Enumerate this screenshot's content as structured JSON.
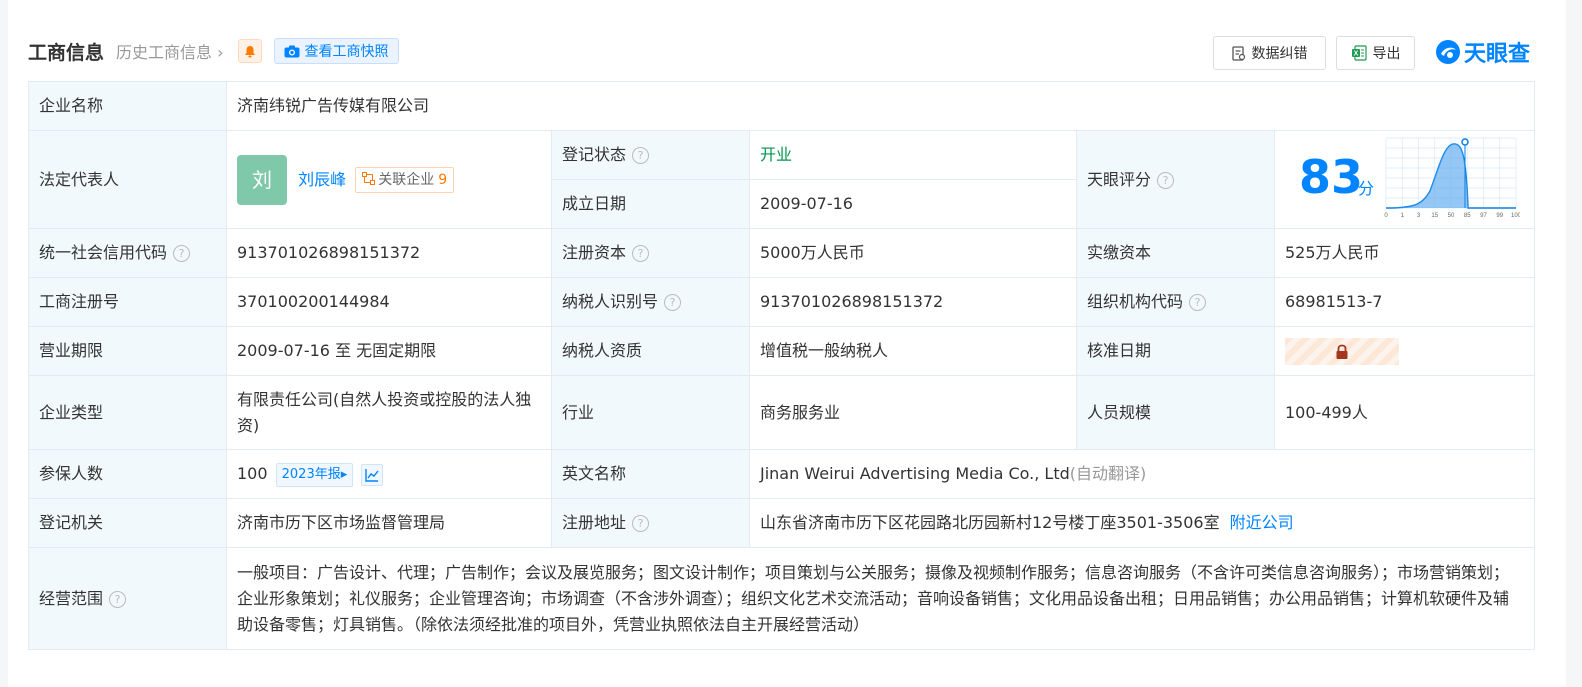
{
  "header": {
    "title": "工商信息",
    "history_link": "历史工商信息",
    "snapshot_button": "查看工商快照",
    "data_correction_button": "数据纠错",
    "export_button": "导出",
    "brand": "天眼查"
  },
  "company": {
    "name_label": "企业名称",
    "name": "济南纬锐广告传媒有限公司",
    "legal_rep_label": "法定代表人",
    "legal_rep_avatar": "刘",
    "legal_rep": "刘辰峰",
    "related_label": "关联企业",
    "related_count": "9",
    "status_label": "登记状态",
    "status": "开业",
    "established_label": "成立日期",
    "established": "2009-07-16",
    "score_label": "天眼评分",
    "score": "83",
    "score_unit": "分",
    "score_axis": [
      "0",
      "1",
      "3",
      "15",
      "50",
      "85",
      "97",
      "99",
      "100"
    ],
    "credit_code_label": "统一社会信用代码",
    "credit_code": "913701026898151372",
    "reg_capital_label": "注册资本",
    "reg_capital": "5000万人民币",
    "paid_capital_label": "实缴资本",
    "paid_capital": "525万人民币",
    "reg_number_label": "工商注册号",
    "reg_number": "370100200144984",
    "taxpayer_id_label": "纳税人识别号",
    "taxpayer_id": "913701026898151372",
    "org_code_label": "组织机构代码",
    "org_code": "68981513-7",
    "term_label": "营业期限",
    "term": "2009-07-16 至 无固定期限",
    "taxpayer_qual_label": "纳税人资质",
    "taxpayer_qual": "增值税一般纳税人",
    "approval_date_label": "核准日期",
    "type_label": "企业类型",
    "type": "有限责任公司(自然人投资或控股的法人独资)",
    "industry_label": "行业",
    "industry": "商务服务业",
    "staff_label": "人员规模",
    "staff": "100-499人",
    "insured_label": "参保人数",
    "insured": "100",
    "annual_report": "2023年报",
    "english_name_label": "英文名称",
    "english_name": "Jinan Weirui Advertising Media Co., Ltd",
    "auto_translate": "(自动翻译)",
    "authority_label": "登记机关",
    "authority": "济南市历下区市场监督管理局",
    "address_label": "注册地址",
    "address": "山东省济南市历下区花园路北历园新村12号楼丁座3501-3506室",
    "nearby_link": "附近公司",
    "scope_label": "经营范围",
    "scope": "一般项目：广告设计、代理；广告制作；会议及展览服务；图文设计制作；项目策划与公关服务；摄像及视频制作服务；信息咨询服务（不含许可类信息咨询服务）；市场营销策划；企业形象策划；礼仪服务；企业管理咨询；市场调查（不含涉外调查）；组织文化艺术交流活动；音响设备销售；文化用品设备出租；日用品销售；办公用品销售；计算机软硬件及辅助设备零售；灯具销售。（除依法须经批准的项目外，凭营业执照依法自主开展经营活动）"
  },
  "colors": {
    "accent": "#0084ff",
    "status_green": "#00964e",
    "label_bg": "#f2f9fc",
    "border": "#e4eaf2"
  }
}
